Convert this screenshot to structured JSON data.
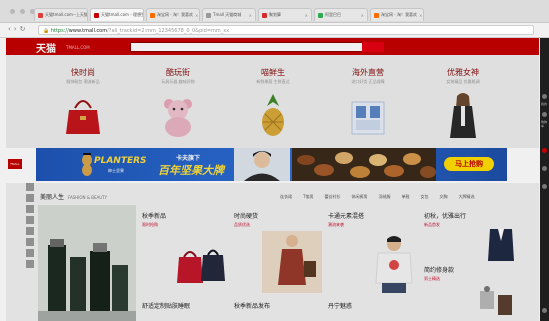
{
  "browser": {
    "tabs": [
      {
        "label": "天猫tmall.com--上天猫…",
        "favicon_color": "#e23b3b"
      },
      {
        "label": "天猫tmall.com - 理想生…",
        "favicon_color": "#c40000",
        "active": true
      },
      {
        "label": "淘宝网 - 淘！我喜欢",
        "favicon_color": "#ff6a00"
      },
      {
        "label": "Tmall 天猫商城",
        "favicon_color": "#999999"
      },
      {
        "label": "聚划算",
        "favicon_color": "#d72b2b"
      },
      {
        "label": "阿里巴巴",
        "favicon_color": "#2eaa4f"
      },
      {
        "label": "淘宝网 - 淘！我喜欢",
        "favicon_color": "#ff6a00"
      }
    ],
    "url_scheme": "https://",
    "url_host": "www.tmall.com",
    "url_path": "/?ali_trackid=2:mm_12345678_0_0&pid=mm_xx"
  },
  "header": {
    "logo": "天猫",
    "logo_sub": "TMALL.COM"
  },
  "categories": [
    {
      "title": "快时尚",
      "subtitle": "服饰鞋包 潮流新品",
      "icon": "handbag-icon"
    },
    {
      "title": "酷玩街",
      "subtitle": "玩具乐器 趣味好物",
      "icon": "teddy-bear-icon"
    },
    {
      "title": "喵鲜生",
      "subtitle": "新鲜果蔬 生鲜直达",
      "icon": "pineapple-icon"
    },
    {
      "title": "海外直营",
      "subtitle": "进口好货 正品保障",
      "icon": "milk-box-icon"
    },
    {
      "title": "优雅女神",
      "subtitle": "女装精品 优雅格调",
      "icon": "model-icon"
    }
  ],
  "banner": {
    "tmall_badge": "TMALL",
    "brand": "PLANTERS",
    "brand_cn": "绅士坚果",
    "slogan_top": "卡夫旗下",
    "slogan_main": "百年坚果大牌",
    "cta": "马上抢购",
    "colors": {
      "bg": "#2361c6",
      "accent": "#ffe13a",
      "cta_text": "#c40000"
    }
  },
  "floor": {
    "title": "美丽人生",
    "title_en": "FASHION & BEAUTY",
    "links": [
      "连衣裙",
      "T恤男",
      "蕾丝衬衫",
      "休闲裤男",
      "羽绒服",
      "单鞋",
      "女包",
      "文胸",
      "大牌精选"
    ],
    "promos": [
      {
        "title": "秋季新品",
        "subtitle": "限时抢购"
      },
      {
        "title": "时尚硬货",
        "subtitle": "品质优选"
      },
      {
        "title": "卡通元素混搭",
        "subtitle": "潮流来袭"
      },
      {
        "title": "初秋，优雅出行",
        "subtitle": "新品首发"
      },
      {
        "title": "简约修身款",
        "subtitle": "男士精选"
      },
      {
        "title": "舒适定制贴肤睡眠",
        "subtitle": ""
      },
      {
        "title": "秋季新品发布",
        "subtitle": ""
      },
      {
        "title": "丹宁魅惑",
        "subtitle": ""
      }
    ]
  },
  "sidebar_icons": [
    "user-icon",
    "cart-icon",
    "heart-icon",
    "history-icon",
    "coupon-icon",
    "top-icon"
  ],
  "sidebar_labels": [
    "我的",
    "购物车"
  ]
}
